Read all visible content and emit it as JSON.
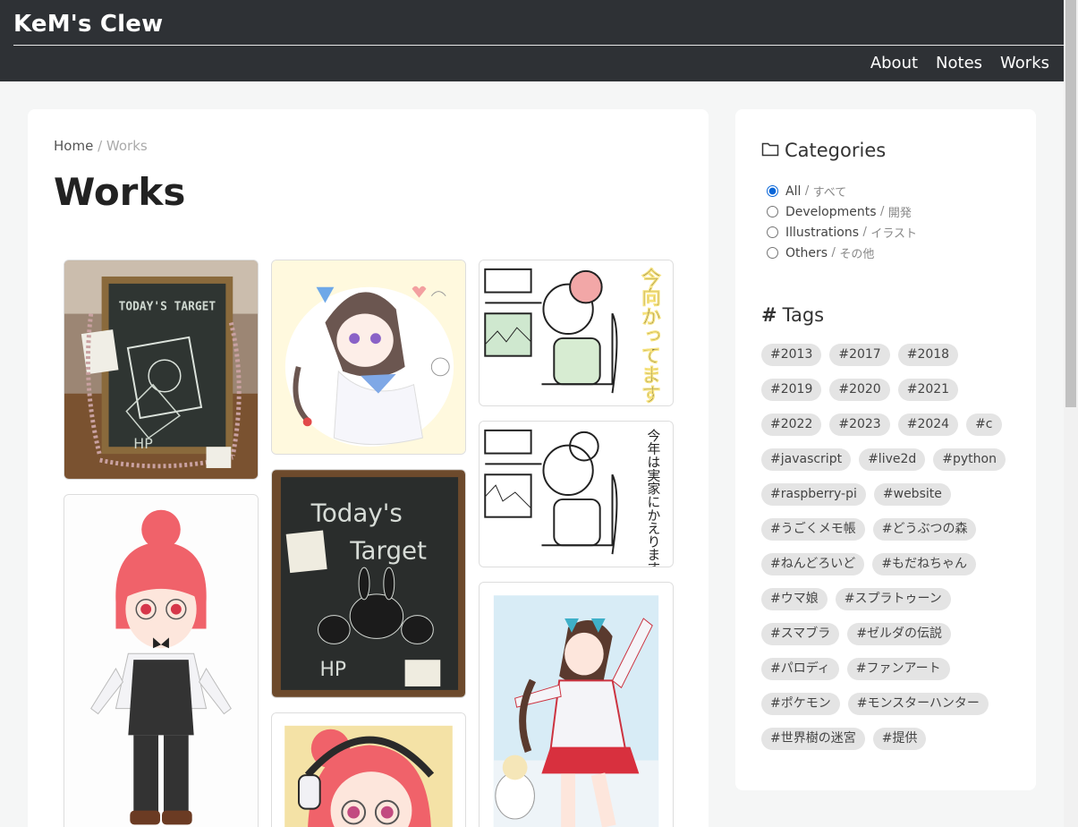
{
  "header": {
    "site_title": "KeM's Clew",
    "nav": [
      "About",
      "Notes",
      "Works"
    ]
  },
  "breadcrumb": {
    "home": "Home",
    "separator": "/",
    "current": "Works"
  },
  "page_title": "Works",
  "works": [
    {
      "subject": "chalkboard-todays-target-photo"
    },
    {
      "subject": "anime-girl-bow-sketch"
    },
    {
      "subject": "doodle-girl-imamukattemasu"
    },
    {
      "subject": "doodle-girl-kotoshi-wa-jikka"
    },
    {
      "subject": "live2d-character-red-hair"
    },
    {
      "subject": "chalkboard-todays-target-rabbits-photo"
    },
    {
      "subject": "red-hair-girl-headphones"
    },
    {
      "subject": "uma-musume-fan-art"
    }
  ],
  "image_text": {
    "chalkboard1": "TODAY'S TARGET",
    "chalkboard2_line1": "Today's",
    "chalkboard2_line2": "Target",
    "hp": "HP",
    "doodle1_text": "今向かってます",
    "doodle2_text": "今年は実家にかえります"
  },
  "sidebar": {
    "categories_title": "Categories",
    "categories": [
      {
        "label": "All",
        "jp": "すべて",
        "checked": true
      },
      {
        "label": "Developments",
        "jp": "開発",
        "checked": false
      },
      {
        "label": "Illustrations",
        "jp": "イラスト",
        "checked": false
      },
      {
        "label": "Others",
        "jp": "その他",
        "checked": false
      }
    ],
    "cat_separator": "/",
    "tags_title": "Tags",
    "tags": [
      "#2013",
      "#2017",
      "#2018",
      "#2019",
      "#2020",
      "#2021",
      "#2022",
      "#2023",
      "#2024",
      "#c",
      "#javascript",
      "#live2d",
      "#python",
      "#raspberry-pi",
      "#website",
      "#うごくメモ帳",
      "#どうぶつの森",
      "#ねんどろいど",
      "#もだねちゃん",
      "#ウマ娘",
      "#スプラトゥーン",
      "#スマブラ",
      "#ゼルダの伝説",
      "#パロディ",
      "#ファンアート",
      "#ポケモン",
      "#モンスターハンター",
      "#世界樹の迷宮",
      "#提供"
    ]
  },
  "colors": {
    "header_bg": "#2e3135",
    "page_bg": "#f5f6f6",
    "tag_bg": "#e4e4e4",
    "radio_accent": "#0a66d8",
    "character_hair": "#f0626a"
  }
}
